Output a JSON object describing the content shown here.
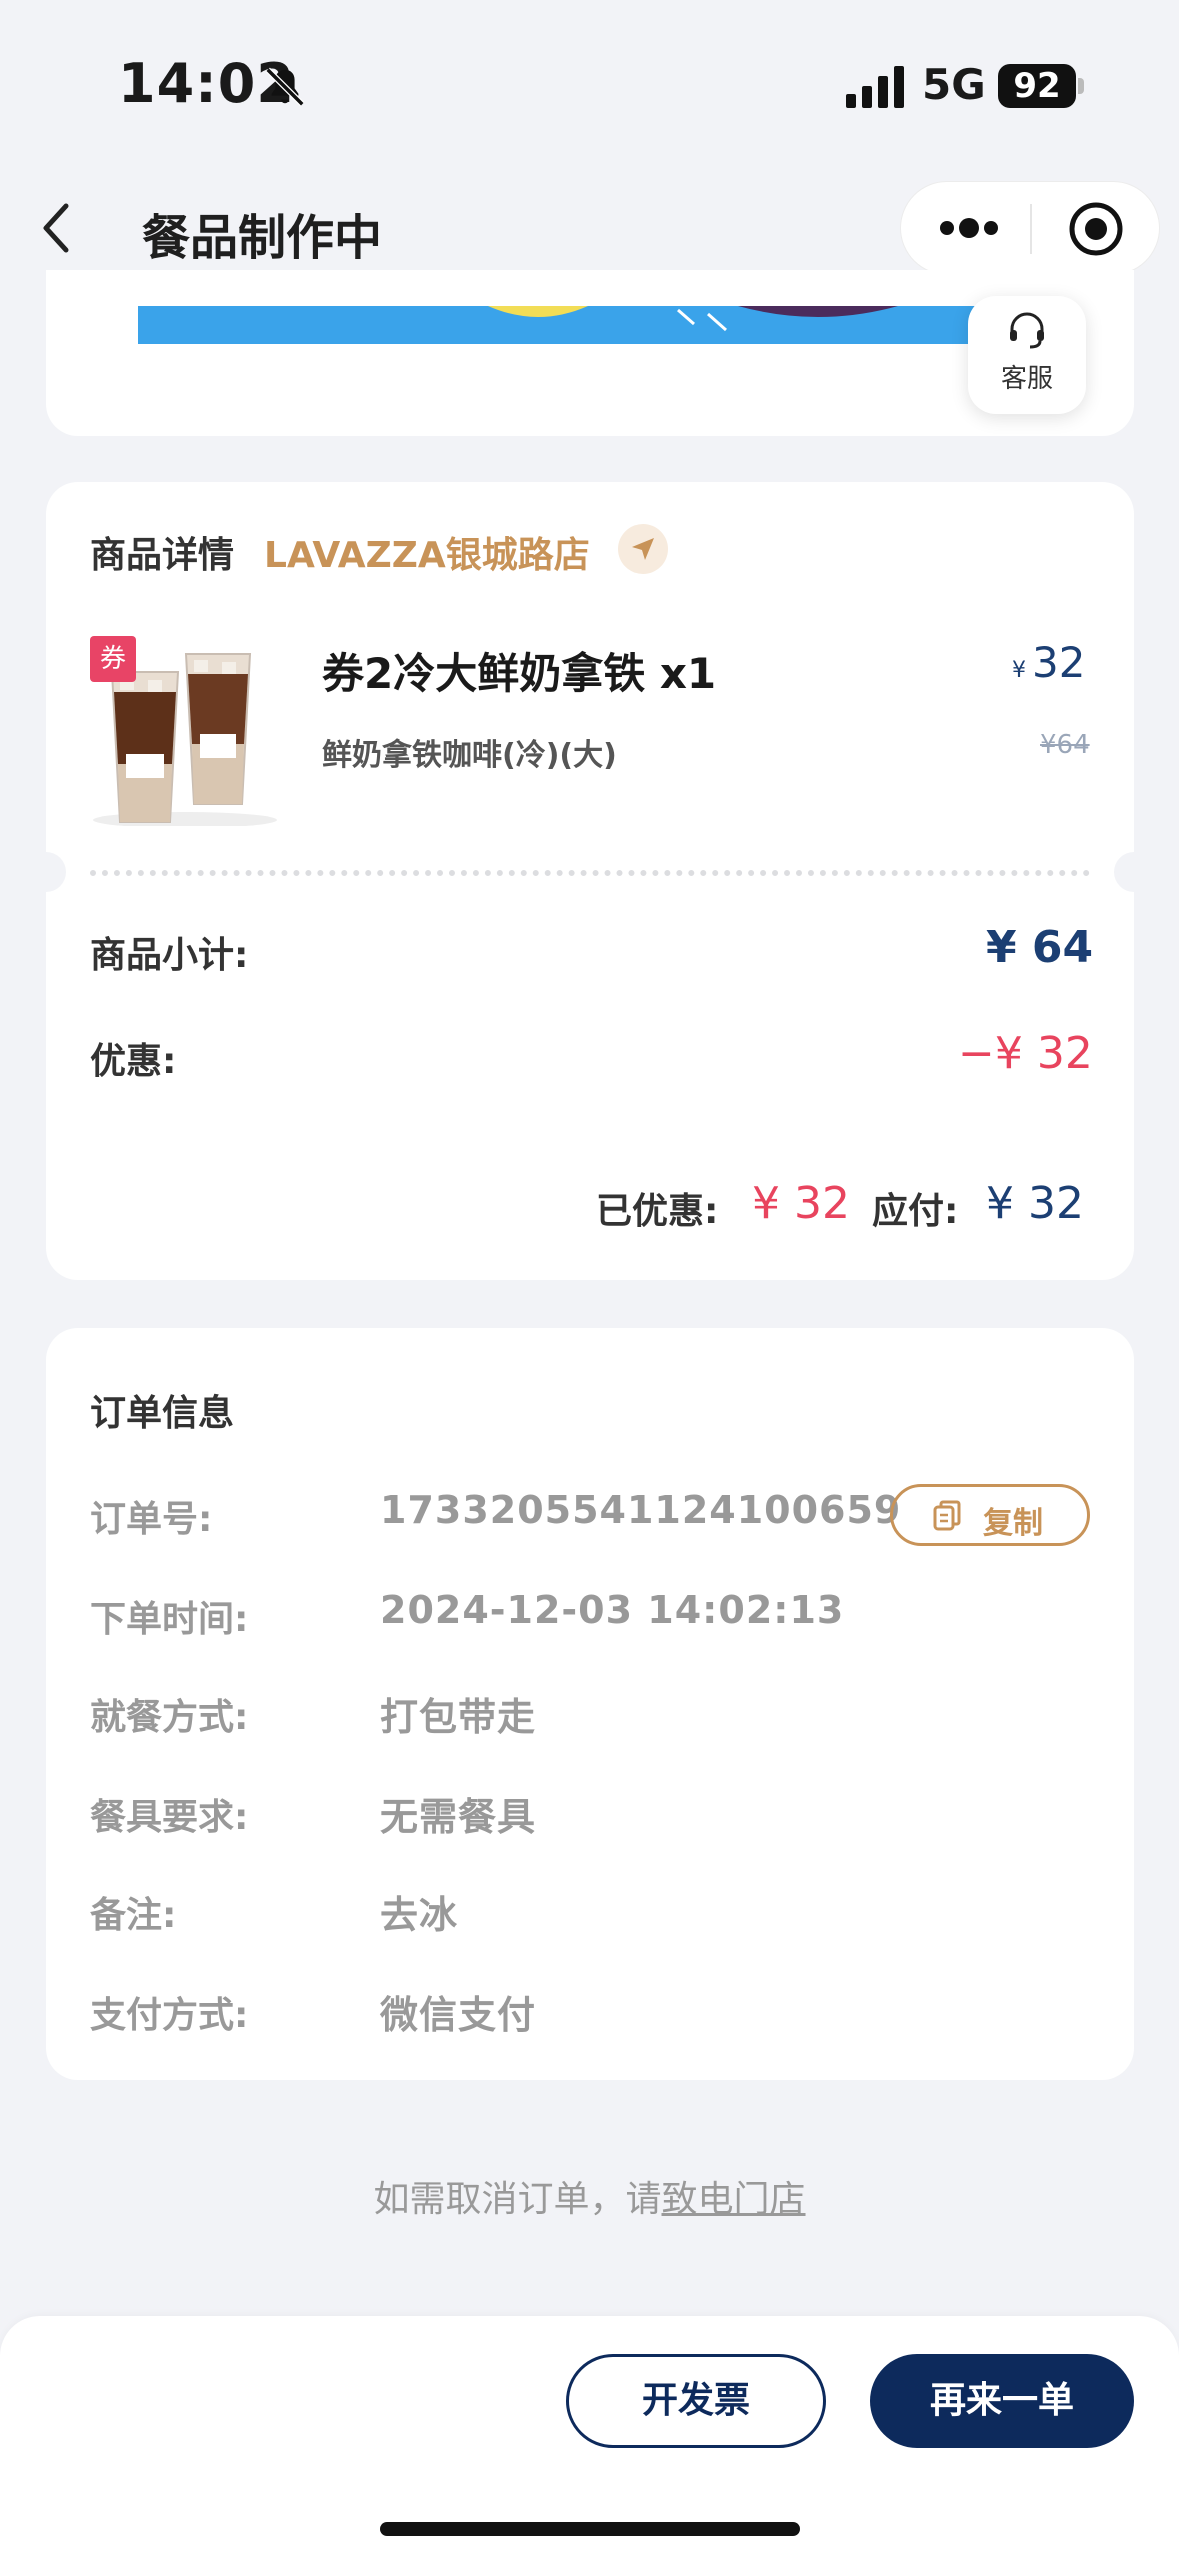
{
  "status_bar": {
    "time": "14:02",
    "network": "5G",
    "battery": "92"
  },
  "nav": {
    "title": "餐品制作中",
    "more_icon": "more-dots-icon",
    "close_icon": "target-close-icon"
  },
  "service": {
    "label": "客服",
    "icon": "headset-icon"
  },
  "product_section": {
    "title": "商品详情",
    "store": "LAVAZZA银城路店",
    "locate_icon": "navigation-arrow-icon",
    "item": {
      "coupon_tag": "券",
      "name": "券2冷大鲜奶拿铁 x1",
      "spec": "鲜奶拿铁咖啡(冷)(大)",
      "price_currency": "¥",
      "price": "32",
      "original_price": "¥64"
    },
    "subtotal_label": "商品小计:",
    "subtotal_value": "¥ 64",
    "discount_label": "优惠:",
    "discount_value": "−¥ 32",
    "saved_label": "已优惠:",
    "saved_value": "¥ 32",
    "payable_label": "应付:",
    "payable_value": "¥ 32"
  },
  "order_section": {
    "title": "订单信息",
    "copy_label": "复制",
    "rows": [
      {
        "label": "订单号:",
        "value": "1733205541124100659"
      },
      {
        "label": "下单时间:",
        "value": "2024-12-03 14:02:13"
      },
      {
        "label": "就餐方式:",
        "value": "打包带走"
      },
      {
        "label": "餐具要求:",
        "value": "无需餐具"
      },
      {
        "label": "备注:",
        "value": "去冰"
      },
      {
        "label": "支付方式:",
        "value": "微信支付"
      }
    ]
  },
  "hint": {
    "text": "如需取消订单，请",
    "link": "致电门店"
  },
  "actions": {
    "invoice": "开发票",
    "reorder": "再来一单"
  },
  "colors": {
    "brand_navy": "#0d2a5c",
    "accent_gold": "#c89358",
    "discount_red": "#e8445e",
    "background": "#f2f3f7"
  }
}
